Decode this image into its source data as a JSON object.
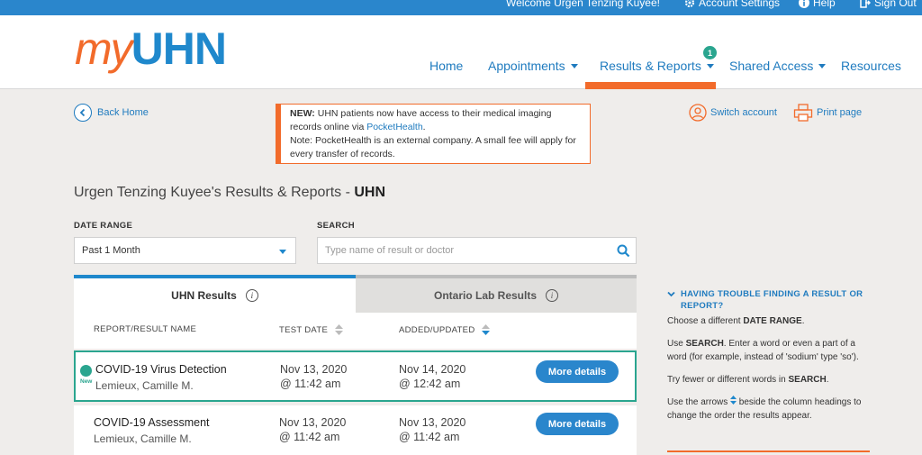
{
  "topbar": {
    "welcome": "Welcome Urgen Tenzing Kuyee!",
    "account_settings": "Account Settings",
    "help": "Help",
    "sign_out": "Sign Out"
  },
  "logo": {
    "my": "my",
    "uhn": "UHN"
  },
  "nav": {
    "home": "Home",
    "appointments": "Appointments",
    "results_reports": "Results & Reports",
    "results_badge": "1",
    "shared_access": "Shared Access",
    "resources": "Resources"
  },
  "back_home": "Back Home",
  "notice": {
    "new_label": "NEW:",
    "line1": " UHN patients now have access to their medical imaging records online via ",
    "link": "PocketHealth",
    "line1_end": ".",
    "note": "Note: PocketHealth is an external company. A small fee will apply for every transfer of records."
  },
  "switch_account": "Switch account",
  "print_page": "Print page",
  "page_title": {
    "prefix": "Urgen Tenzing Kuyee's Results & Reports - ",
    "org": "UHN"
  },
  "filters": {
    "date_range_label": "DATE RANGE",
    "date_range_value": "Past 1 Month",
    "search_label": "SEARCH",
    "search_placeholder": "Type name of result or doctor"
  },
  "tabs": {
    "uhn": "UHN Results",
    "ontario": "Ontario Lab Results"
  },
  "table": {
    "headers": {
      "name": "REPORT/RESULT NAME",
      "test_date": "TEST DATE",
      "added": "ADDED/UPDATED"
    },
    "rows": [
      {
        "name": "COVID-19 Virus Detection",
        "doctor": "Lemieux, Camille M.",
        "test_date": "Nov 13, 2020",
        "test_time": "@ 11:42 am",
        "added_date": "Nov 14, 2020",
        "added_time": "@ 12:42 am",
        "button": "More details",
        "new_label": "New"
      },
      {
        "name": "COVID-19 Assessment",
        "doctor": "Lemieux, Camille M.",
        "test_date": "Nov 13, 2020",
        "test_time": "@ 11:42 am",
        "added_date": "Nov 13, 2020",
        "added_time": "@ 11:42 am",
        "button": "More details"
      }
    ]
  },
  "help": {
    "title": "HAVING TROUBLE FINDING A RESULT OR REPORT?",
    "p1_a": "Choose a different ",
    "p1_kw": "DATE RANGE",
    "p1_b": ".",
    "p2_a": "Use ",
    "p2_kw": "SEARCH",
    "p2_b": ". Enter a word or even a part of a word (for example, instead of 'sodium' type 'so').",
    "p3_a": "Try fewer or different words in ",
    "p3_kw": "SEARCH",
    "p3_b": ".",
    "p4_a": "Use the arrows ",
    "p4_b": " beside the column headings to change the order the results appear."
  },
  "colors": {
    "brand_blue": "#1f88cc",
    "brand_orange": "#f26b2b",
    "accent_teal": "#2aa58f"
  }
}
